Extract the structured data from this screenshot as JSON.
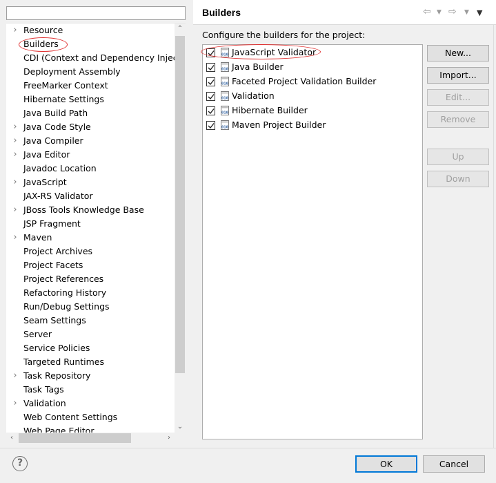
{
  "filter": {
    "value": "",
    "placeholder": ""
  },
  "tree": {
    "items": [
      {
        "label": "Resource",
        "expandable": true
      },
      {
        "label": "Builders",
        "expandable": false
      },
      {
        "label": "CDI (Context and Dependency Injection)",
        "expandable": false
      },
      {
        "label": "Deployment Assembly",
        "expandable": false
      },
      {
        "label": "FreeMarker Context",
        "expandable": false
      },
      {
        "label": "Hibernate Settings",
        "expandable": false
      },
      {
        "label": "Java Build Path",
        "expandable": false
      },
      {
        "label": "Java Code Style",
        "expandable": true
      },
      {
        "label": "Java Compiler",
        "expandable": true
      },
      {
        "label": "Java Editor",
        "expandable": true
      },
      {
        "label": "Javadoc Location",
        "expandable": false
      },
      {
        "label": "JavaScript",
        "expandable": true
      },
      {
        "label": "JAX-RS Validator",
        "expandable": false
      },
      {
        "label": "JBoss Tools Knowledge Base",
        "expandable": true
      },
      {
        "label": "JSP Fragment",
        "expandable": false
      },
      {
        "label": "Maven",
        "expandable": true
      },
      {
        "label": "Project Archives",
        "expandable": false
      },
      {
        "label": "Project Facets",
        "expandable": false
      },
      {
        "label": "Project References",
        "expandable": false
      },
      {
        "label": "Refactoring History",
        "expandable": false
      },
      {
        "label": "Run/Debug Settings",
        "expandable": false
      },
      {
        "label": "Seam Settings",
        "expandable": false
      },
      {
        "label": "Server",
        "expandable": false
      },
      {
        "label": "Service Policies",
        "expandable": false
      },
      {
        "label": "Targeted Runtimes",
        "expandable": false
      },
      {
        "label": "Task Repository",
        "expandable": true
      },
      {
        "label": "Task Tags",
        "expandable": false
      },
      {
        "label": "Validation",
        "expandable": true
      },
      {
        "label": "Web Content Settings",
        "expandable": false
      },
      {
        "label": "Web Page Editor",
        "expandable": false
      }
    ]
  },
  "page": {
    "title": "Builders",
    "description": "Configure the builders for the project:"
  },
  "builders": [
    {
      "label": "JavaScript Validator",
      "checked": true
    },
    {
      "label": "Java Builder",
      "checked": true
    },
    {
      "label": "Faceted Project Validation Builder",
      "checked": true
    },
    {
      "label": "Validation",
      "checked": true
    },
    {
      "label": "Hibernate Builder",
      "checked": true
    },
    {
      "label": "Maven Project Builder",
      "checked": true
    }
  ],
  "buttons": {
    "new": "New...",
    "import": "Import...",
    "edit": "Edit...",
    "remove": "Remove",
    "up": "Up",
    "down": "Down",
    "ok": "OK",
    "cancel": "Cancel"
  },
  "icons": {
    "back": "back-arrow-icon",
    "forward": "forward-arrow-icon",
    "menu": "view-menu-icon",
    "help": "help-icon",
    "builder": "builder-010-icon"
  },
  "colors": {
    "annotation": "#e03030",
    "focus": "#0078d7",
    "builder_icon": "#3465a4"
  }
}
